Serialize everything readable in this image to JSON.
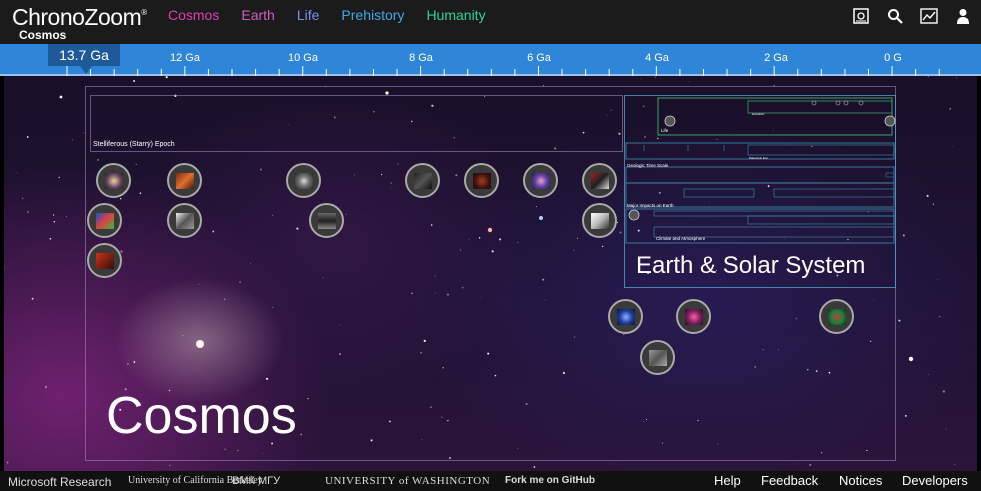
{
  "header": {
    "logo": "ChronoZoom",
    "logo_mark": "®",
    "breadcrumb": "Cosmos",
    "nav": [
      {
        "label": "Cosmos",
        "color": "#e03fb4"
      },
      {
        "label": "Earth",
        "color": "#d25cc4"
      },
      {
        "label": "Life",
        "color": "#7b8ef0"
      },
      {
        "label": "Prehistory",
        "color": "#44a6e8"
      },
      {
        "label": "Humanity",
        "color": "#2fcf9f"
      }
    ],
    "toolbar_icons": [
      "tour-icon",
      "search-icon",
      "chart-icon",
      "user-icon"
    ]
  },
  "ruler": {
    "current": "13.7 Ga",
    "labels": [
      "12 Ga",
      "10 Ga",
      "8 Ga",
      "6 Ga",
      "4 Ga",
      "2 Ga",
      "0 G"
    ],
    "accent": "#2f86d9"
  },
  "canvas": {
    "cosmos_title": "Cosmos",
    "epoch_label": "Stelliferous (Starry) Epoch",
    "earth_title": "Earth & Solar System",
    "earth_sub_labels": {
      "life": "Life",
      "geologic": "Geologic Time Scale",
      "impacts": "Major Impacts on Earth",
      "climate": "Climate and Atmosphere",
      "evolution": "Evolution",
      "paleozoic": "Paleozoic Era"
    }
  },
  "footer": {
    "brands": [
      "Microsoft Research",
      "University of California Berkeley",
      "ВМК МГУ",
      "UNIVERSITY of WASHINGTON",
      "Fork me on GitHub"
    ],
    "links": [
      "Help",
      "Feedback",
      "Notices",
      "Developers"
    ]
  }
}
